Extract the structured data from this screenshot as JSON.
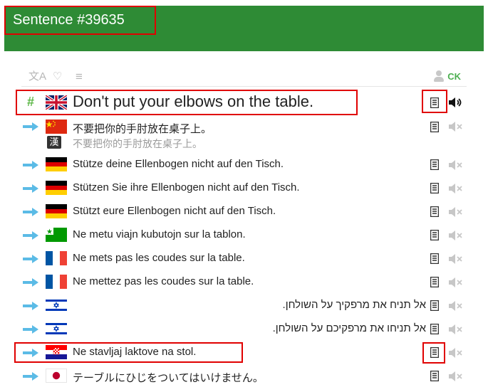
{
  "header": {
    "title": "Sentence #39635"
  },
  "toolbar": {
    "owner": "CK",
    "translate_icon": "文A",
    "heart_icon": "♡",
    "list_icon": "≡"
  },
  "main": {
    "hash": "#",
    "text": "Don't put your elbows on the table."
  },
  "translations": [
    {
      "lang": "zh",
      "text": "不要把你的手肘放在桌子上。",
      "alt": "不要把你的手肘放在桌子上。",
      "alt_badge": "漢"
    },
    {
      "lang": "de",
      "text": "Stütze deine Ellenbogen nicht auf den Tisch."
    },
    {
      "lang": "de",
      "text": "Stützen Sie ihre Ellenbogen nicht auf den Tisch."
    },
    {
      "lang": "de",
      "text": "Stützt eure Ellenbogen nicht auf den Tisch."
    },
    {
      "lang": "eo",
      "text": "Ne metu viajn kubutojn sur la tablon."
    },
    {
      "lang": "fr",
      "text": "Ne mets pas les coudes sur la table."
    },
    {
      "lang": "fr",
      "text": "Ne mettez pas les coudes sur la table."
    },
    {
      "lang": "he",
      "text": "אל תניח את מרפקיך על השולחן."
    },
    {
      "lang": "he",
      "text": "אל תניחו את מרפקיכם על השולחן."
    },
    {
      "lang": "hr",
      "text": "Ne stavljaj laktove na stol."
    },
    {
      "lang": "ja",
      "text": "テーブルにひじをついてはいけません。"
    }
  ],
  "colors": {
    "header": "#2e8b35",
    "accent_green": "#5fb84a",
    "arrow": "#5bbbe6",
    "highlight": "#e00000"
  }
}
